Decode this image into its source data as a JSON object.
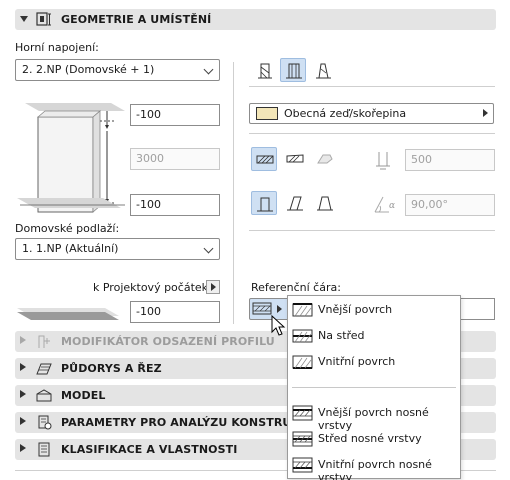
{
  "sections": {
    "geometry": "GEOMETRIE A UMÍSTĚNÍ",
    "profile_offset": "MODIFIKÁTOR ODSAZENÍ PROFILU",
    "floorplan": "PŮDORYS A ŘEZ",
    "model": "MODEL",
    "structural": "PARAMETRY PRO ANALÝZU KONSTRUKCE",
    "classification": "KLASIFIKACE A VLASTNOSTI"
  },
  "left": {
    "top_link_label": "Horní napojení:",
    "top_link_value": "2. 2.NP (Domovské + 1)",
    "top_offset": "-100",
    "height": "3000",
    "bottom_offset": "-100",
    "home_story_label": "Domovské podlaží:",
    "home_story_value": "1. 1.NP (Aktuální)",
    "project_zero_label": "k Projektový počátek",
    "project_zero_value": "-100"
  },
  "right": {
    "structure_value": "Obecná zeď/skořepina",
    "thickness": "500",
    "slant_angle": "90,00°",
    "refline_label": "Referenční čára:"
  },
  "menu": {
    "items": [
      "Vnější povrch",
      "Na střed",
      "Vnitřní povrch",
      "Vnější povrch nosné vrstvy",
      "Střed nosné vrstvy",
      "Vnitřní povrch nosné vrstvy"
    ]
  },
  "colors": {
    "selected_bg": "#cfe0f3",
    "section_bg": "#e4e4e4"
  }
}
